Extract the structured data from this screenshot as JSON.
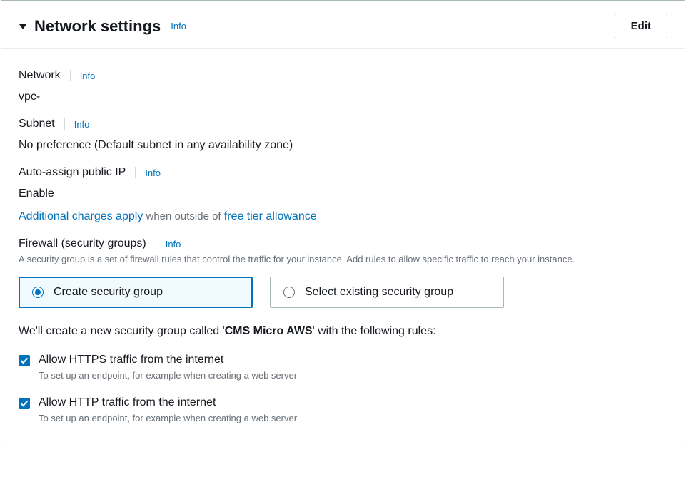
{
  "header": {
    "title": "Network settings",
    "info": "Info",
    "edit": "Edit"
  },
  "network": {
    "label": "Network",
    "info": "Info",
    "value": "vpc-"
  },
  "subnet": {
    "label": "Subnet",
    "info": "Info",
    "value": "No preference (Default subnet in any availability zone)"
  },
  "public_ip": {
    "label": "Auto-assign public IP",
    "info": "Info",
    "value": "Enable"
  },
  "charges": {
    "link1": "Additional charges apply",
    "mid": " when outside of ",
    "link2": "free tier allowance"
  },
  "firewall": {
    "label": "Firewall (security groups)",
    "info": "Info",
    "helper": "A security group is a set of firewall rules that control the traffic for your instance. Add rules to allow specific traffic to reach your instance.",
    "options": {
      "create": "Create security group",
      "select": "Select existing security group"
    }
  },
  "sg": {
    "pre": "We'll create a new security group called '",
    "name": "CMS Micro AWS",
    "post": "' with the following rules:"
  },
  "rules": {
    "https": {
      "label": "Allow HTTPS traffic from the internet",
      "help": "To set up an endpoint, for example when creating a web server"
    },
    "http": {
      "label": "Allow HTTP traffic from the internet",
      "help": "To set up an endpoint, for example when creating a web server"
    }
  }
}
